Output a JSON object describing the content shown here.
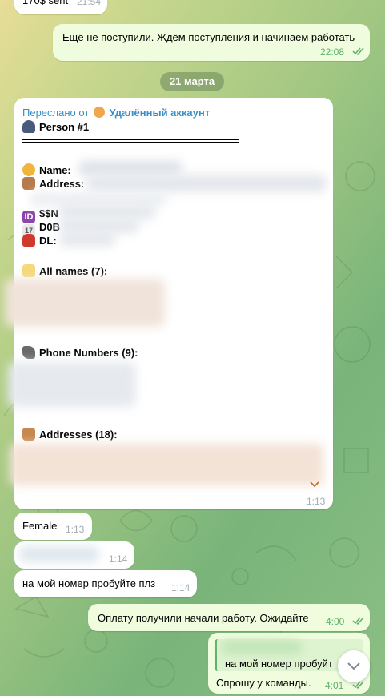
{
  "messages": {
    "m0": {
      "text": "170$ sent",
      "time": "21:54"
    },
    "m1": {
      "text": "Ещё не поступили. Ждём поступления и начинаем работать",
      "time": "22:08"
    },
    "date": "21 марта",
    "fwd": {
      "header": "Переслано от",
      "account": "Удалённый аккаунт",
      "person": "Person #1",
      "name_label": "Name:",
      "address_label": "Address:",
      "ssn_label": "$$N",
      "dob_label": "D0B",
      "dl_label": "DL:",
      "allnames_label": "All names (7):",
      "phones_label": "Phone Numbers (9):",
      "addresses_label": "Addresses (18):",
      "time": "1:13"
    },
    "m_female": {
      "text": "Female",
      "time": "1:13"
    },
    "m_blurred": {
      "time": "1:14"
    },
    "m_number": {
      "text": "на мой номер пробуйте плз",
      "time": "1:14"
    },
    "m_paid": {
      "text": "Оплату получили начали работу. Ожидайте",
      "time": "4:00"
    },
    "m_reply": {
      "quote": "на мой номер пробуйт",
      "text": "Спрошу у команды.",
      "time": "4:01"
    }
  },
  "colors": {
    "incoming": "#ffffff",
    "outgoing": "#effdde",
    "link": "#3a8ec4",
    "check": "#5fb06a"
  },
  "icons": [
    "ghost-icon",
    "person-icon",
    "smile-icon",
    "house-icon",
    "id-icon",
    "calendar-icon",
    "car-icon",
    "memo-icon",
    "phone-icon",
    "home-icon",
    "chevron-down-icon",
    "double-check-icon"
  ]
}
